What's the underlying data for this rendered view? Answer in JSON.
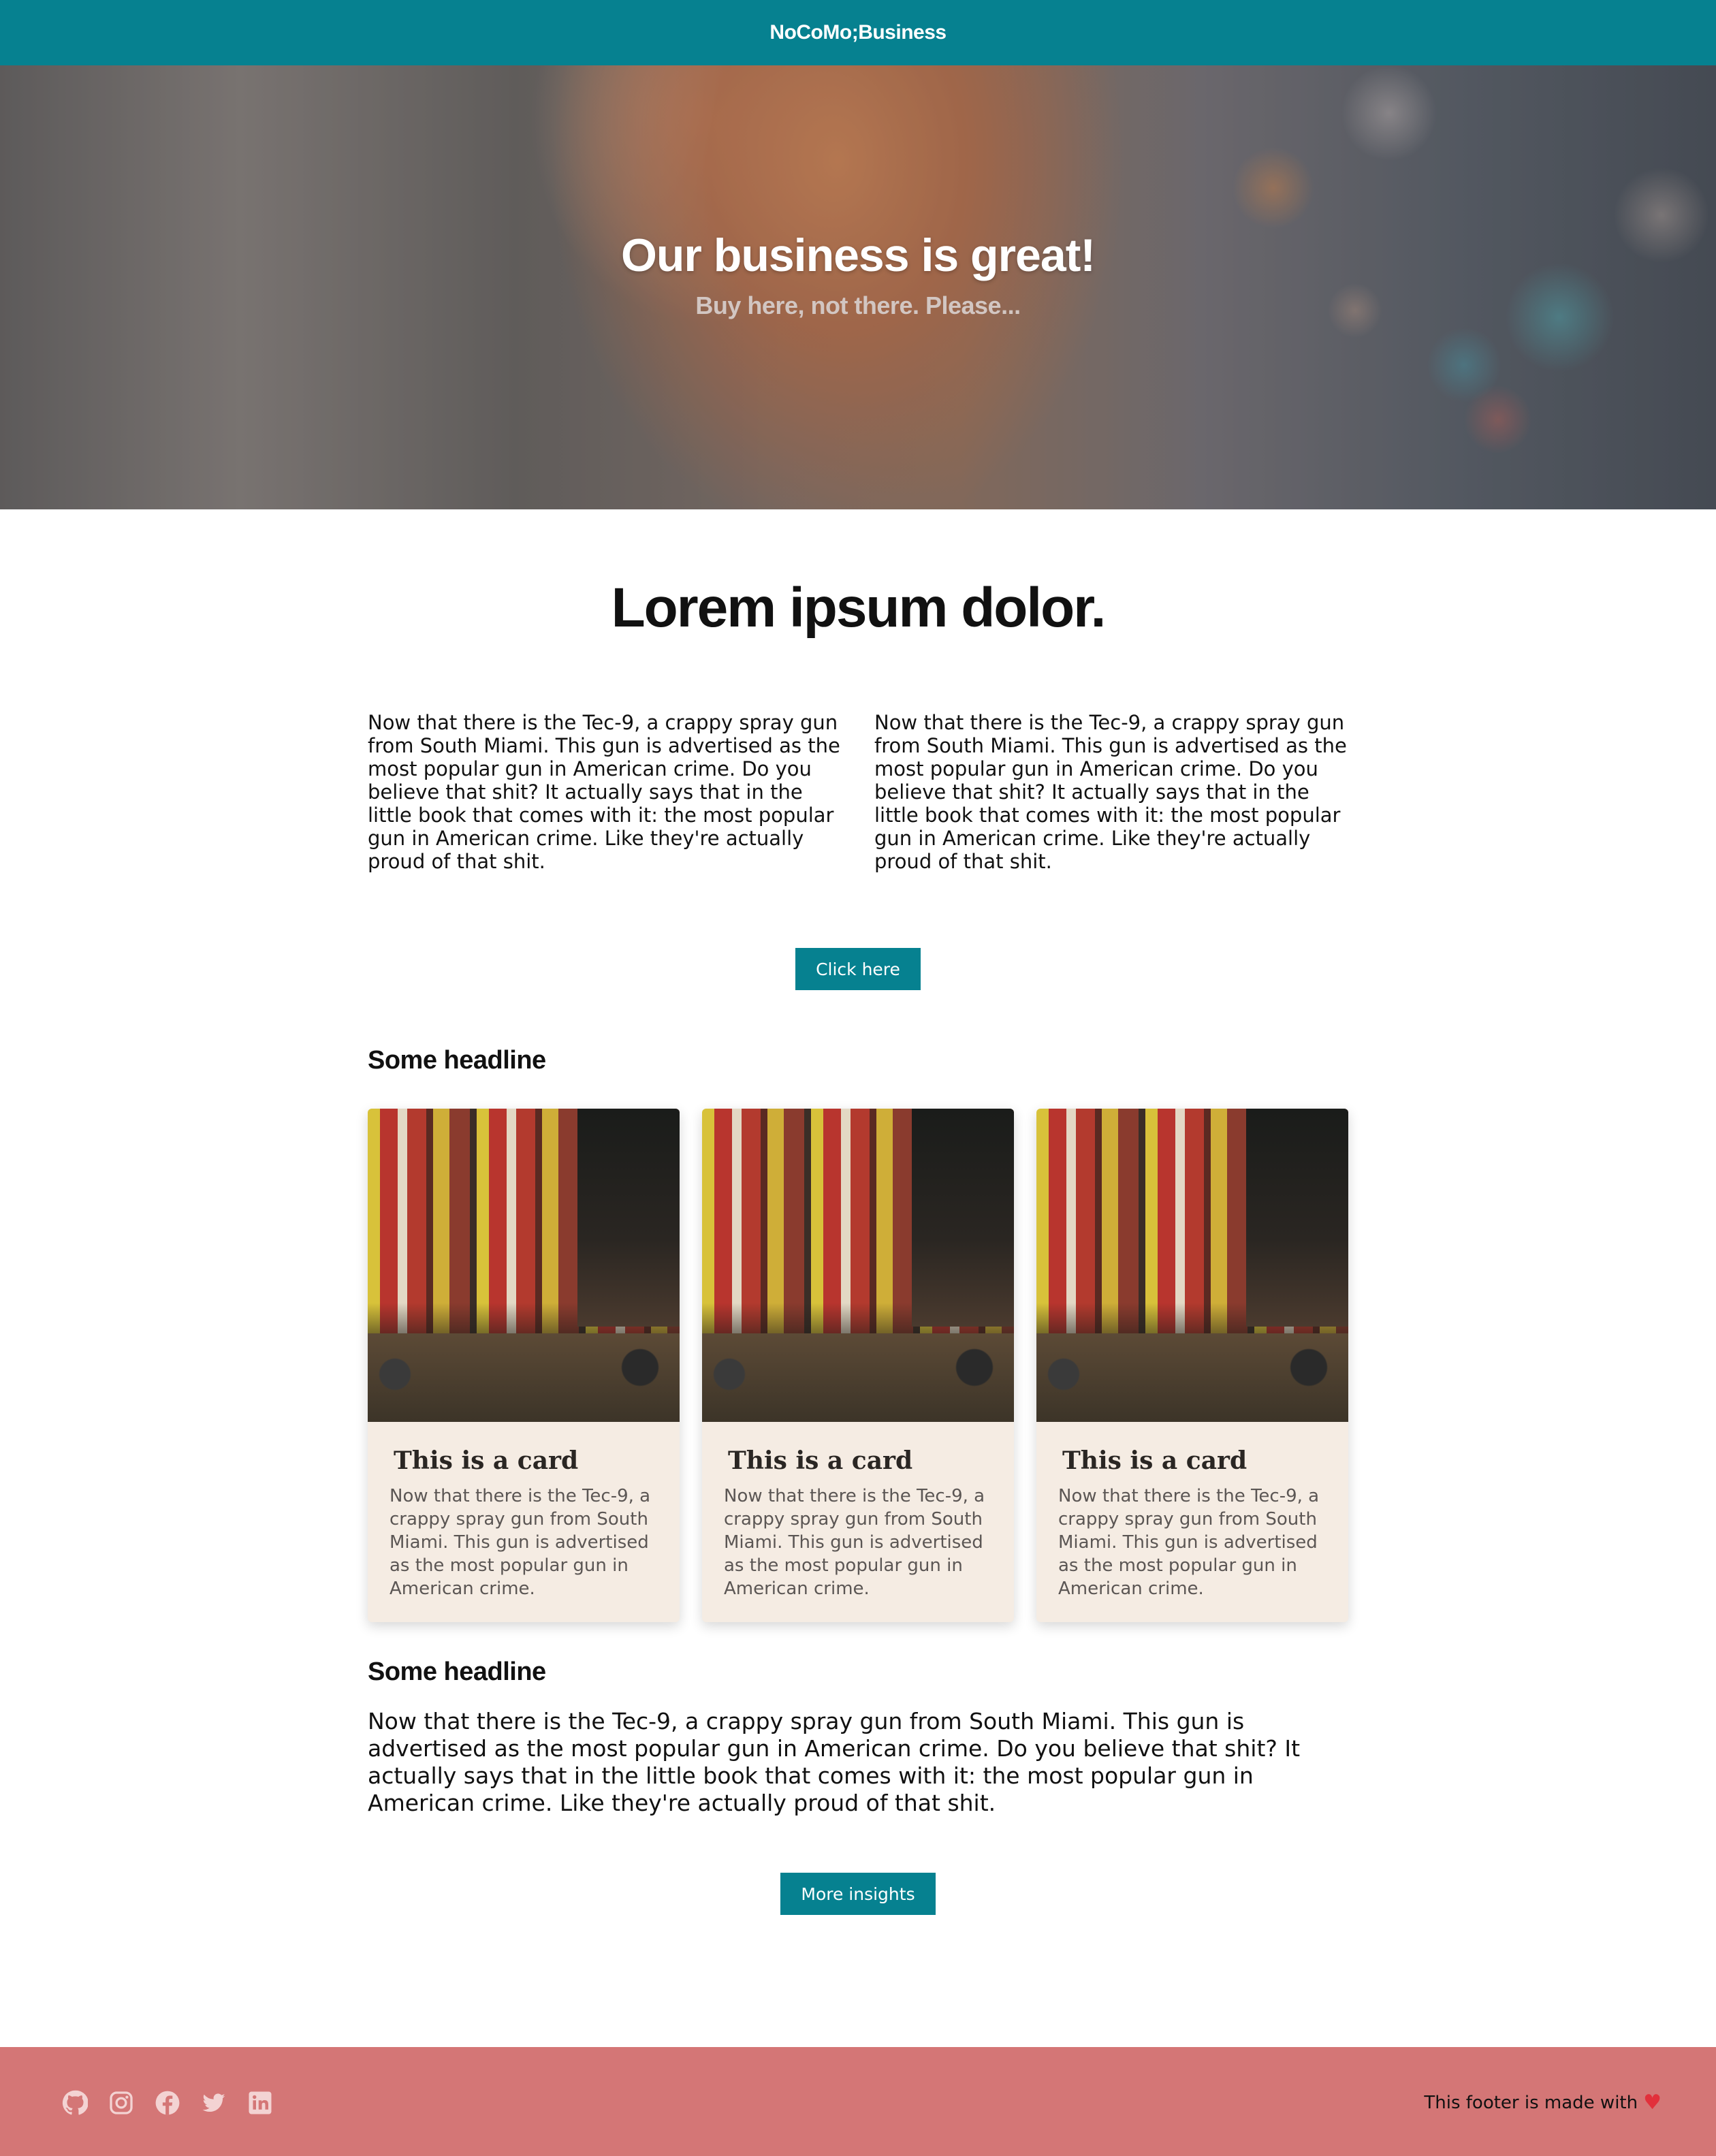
{
  "navbar": {
    "brand": "NoCoMo;Business"
  },
  "hero": {
    "title": "Our business is great!",
    "subtitle": "Buy here, not there. Please..."
  },
  "intro": {
    "title": "Lorem ipsum dolor.",
    "columns": [
      "Now that there is the Tec-9, a crappy spray gun from South Miami. This gun is advertised as the most popular gun in American crime. Do you believe that shit? It actually says that in the little book that comes with it: the most popular gun in American crime. Like they're actually proud of that shit.",
      "Now that there is the Tec-9, a crappy spray gun from South Miami. This gun is advertised as the most popular gun in American crime. Do you believe that shit? It actually says that in the little book that comes with it: the most popular gun in American crime. Like they're actually proud of that shit."
    ],
    "button_label": "Click here"
  },
  "cards_section": {
    "headline": "Some headline",
    "cards": [
      {
        "title": "This is a card",
        "text": "Now that there is the Tec-9, a crappy spray gun from South Miami. This gun is advertised as the most popular gun in American crime."
      },
      {
        "title": "This is a card",
        "text": "Now that there is the Tec-9, a crappy spray gun from South Miami. This gun is advertised as the most popular gun in American crime."
      },
      {
        "title": "This is a card",
        "text": "Now that there is the Tec-9, a crappy spray gun from South Miami. This gun is advertised as the most popular gun in American crime."
      }
    ]
  },
  "insights_section": {
    "headline": "Some headline",
    "paragraph": "Now that there is the Tec-9, a crappy spray gun from South Miami. This gun is advertised as the most popular gun in American crime. Do you believe that shit? It actually says that in the little book that comes with it: the most popular gun in American crime. Like they're actually proud of that shit.",
    "button_label": "More insights"
  },
  "footer": {
    "icons": [
      "github-icon",
      "instagram-icon",
      "facebook-icon",
      "twitter-icon",
      "linkedin-icon"
    ],
    "text": "This footer is made with",
    "heart": "♥"
  },
  "colors": {
    "accent": "#068190",
    "footer_bg": "#d47676",
    "card_bg": "#f5ece3",
    "heart": "#e2303b"
  }
}
